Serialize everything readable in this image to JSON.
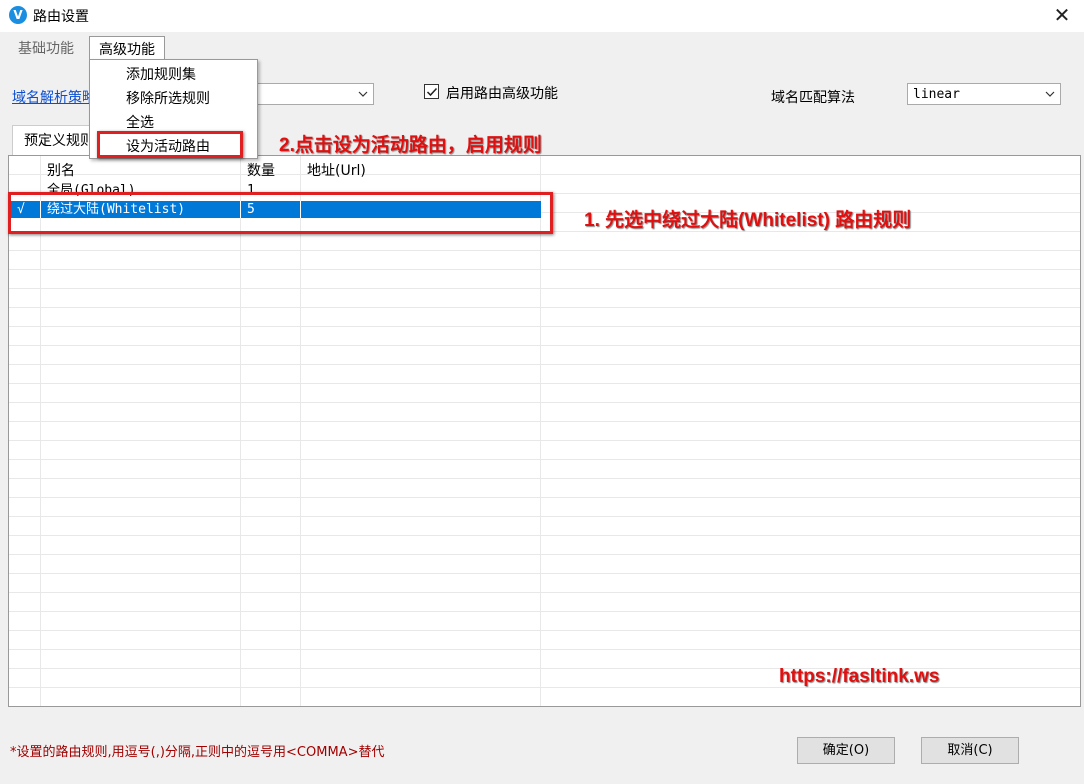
{
  "window": {
    "title": "路由设置",
    "app_icon_letter": "V",
    "close_glyph": "✕"
  },
  "menu": {
    "basic": "基础功能",
    "advanced": "高级功能"
  },
  "dropdown": {
    "items": [
      "添加规则集",
      "移除所选规则",
      "全选",
      "设为活动路由"
    ]
  },
  "settings": {
    "dns_policy_label": "域名解析策略",
    "enable_advanced_label": "启用路由高级功能",
    "enable_advanced_checked": true,
    "match_algo_label": "域名匹配算法",
    "match_algo_value": "linear"
  },
  "tabs": {
    "predefined": "预定义规则"
  },
  "table": {
    "columns": [
      "别名",
      "数量",
      "地址(Url)"
    ],
    "rows": [
      {
        "active": "",
        "alias": "全局(Global)",
        "count": "1",
        "url": ""
      },
      {
        "active": "√",
        "alias": "绕过大陆(Whitelist)",
        "count": "5",
        "url": ""
      }
    ],
    "selected_row": 1
  },
  "annotations": {
    "step1": "1. 先选中绕过大陆(Whitelist) 路由规则",
    "step2": "2.点击设为活动路由，启用规则",
    "watermark": "https://fasltink.ws"
  },
  "footer": {
    "note": "*设置的路由规则,用逗号(,)分隔,正则中的逗号用<COMMA>替代",
    "ok_button": "确定(O)",
    "cancel_button": "取消(C)"
  },
  "colors": {
    "selection": "#0078d7",
    "annotation": "#e01010",
    "link": "#0b4fd0"
  }
}
